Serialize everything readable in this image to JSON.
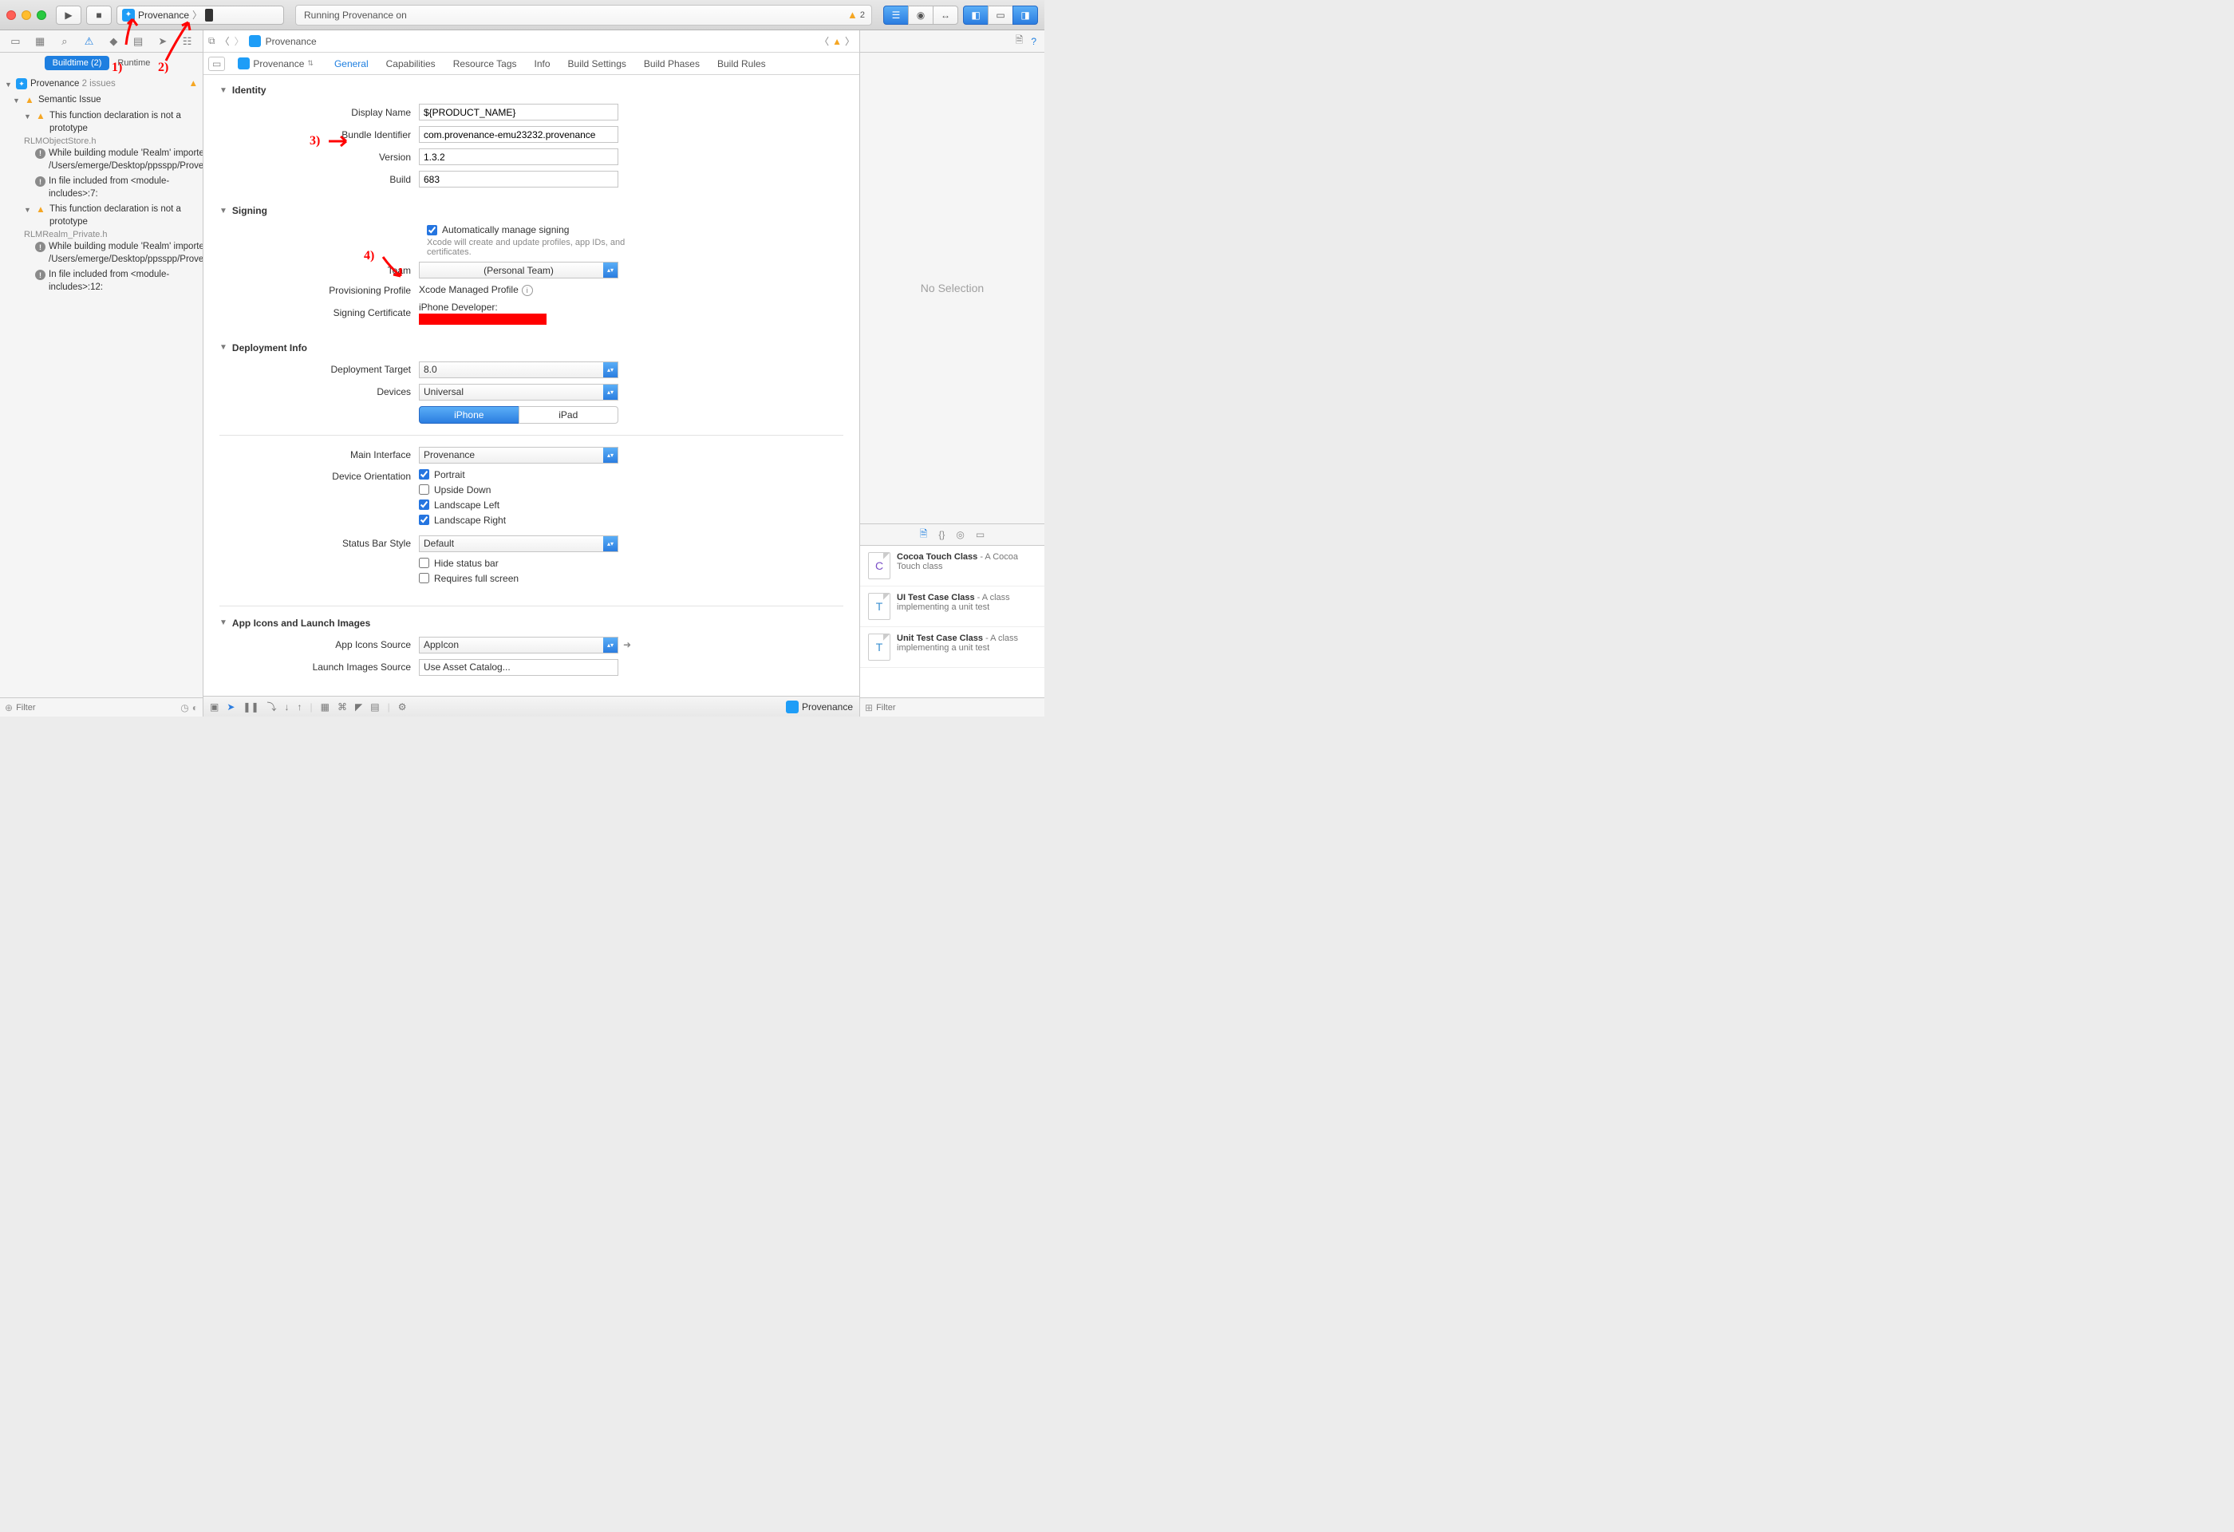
{
  "toolbar": {
    "scheme": "Provenance",
    "status": "Running Provenance on",
    "warning_count": "2"
  },
  "navigator": {
    "tabs": {
      "buildtime": "Buildtime (2)",
      "runtime": "Runtime"
    },
    "root": {
      "name": "Provenance",
      "meta": "2 issues"
    },
    "semantic_issue": "Semantic Issue",
    "issue1": {
      "msg": "This function declaration is not a prototype",
      "file": "RLMObjectStore.h",
      "sub1": "While building module 'Realm' imported from /Users/emerge/Desktop/ppsspp/Provenance/...",
      "sub2": "In file included from <module-includes>:7:"
    },
    "issue2": {
      "msg": "This function declaration is not a prototype",
      "file": "RLMRealm_Private.h",
      "sub1": "While building module 'Realm' imported from /Users/emerge/Desktop/ppsspp/Provenance/...",
      "sub2": "In file included from <module-includes>:12:"
    },
    "filter_placeholder": "Filter"
  },
  "jump": {
    "project": "Provenance"
  },
  "target": {
    "name": "Provenance",
    "tabs": [
      "General",
      "Capabilities",
      "Resource Tags",
      "Info",
      "Build Settings",
      "Build Phases",
      "Build Rules"
    ]
  },
  "identity": {
    "title": "Identity",
    "display_name_label": "Display Name",
    "display_name": "${PRODUCT_NAME}",
    "bundle_label": "Bundle Identifier",
    "bundle": "com.provenance-emu23232.provenance",
    "version_label": "Version",
    "version": "1.3.2",
    "build_label": "Build",
    "build": "683"
  },
  "signing": {
    "title": "Signing",
    "auto_label": "Automatically manage signing",
    "auto_note": "Xcode will create and update profiles, app IDs, and certificates.",
    "team_label": "Team",
    "team_value": "(Personal Team)",
    "profile_label": "Provisioning Profile",
    "profile_value": "Xcode Managed Profile",
    "cert_label": "Signing Certificate",
    "cert_value": "iPhone Developer:"
  },
  "deploy": {
    "title": "Deployment Info",
    "target_label": "Deployment Target",
    "target_value": "8.0",
    "devices_label": "Devices",
    "devices_value": "Universal",
    "iphone": "iPhone",
    "ipad": "iPad",
    "main_if_label": "Main Interface",
    "main_if_value": "Provenance",
    "orient_label": "Device Orientation",
    "orient": {
      "portrait": "Portrait",
      "upside": "Upside Down",
      "ll": "Landscape Left",
      "lr": "Landscape Right"
    },
    "statusbar_label": "Status Bar Style",
    "statusbar_value": "Default",
    "hide_sb": "Hide status bar",
    "req_fs": "Requires full screen"
  },
  "appicons": {
    "title": "App Icons and Launch Images",
    "icons_label": "App Icons Source",
    "icons_value": "AppIcon",
    "launch_label": "Launch Images Source",
    "launch_value": "Use Asset Catalog..."
  },
  "debug": {
    "app": "Provenance"
  },
  "inspector": {
    "empty": "No Selection",
    "items": [
      {
        "title": "Cocoa Touch Class",
        "desc": " - A Cocoa Touch class",
        "glyph": "C",
        "cls": "lib-c"
      },
      {
        "title": "UI Test Case Class",
        "desc": " - A class implementing a unit test",
        "glyph": "T",
        "cls": "lib-t"
      },
      {
        "title": "Unit Test Case Class",
        "desc": " - A class implementing a unit test",
        "glyph": "T",
        "cls": "lib-t"
      }
    ],
    "filter_placeholder": "Filter"
  },
  "annotations": {
    "n1": "1)",
    "n2": "2)",
    "n3": "3)",
    "n4": "4)"
  }
}
